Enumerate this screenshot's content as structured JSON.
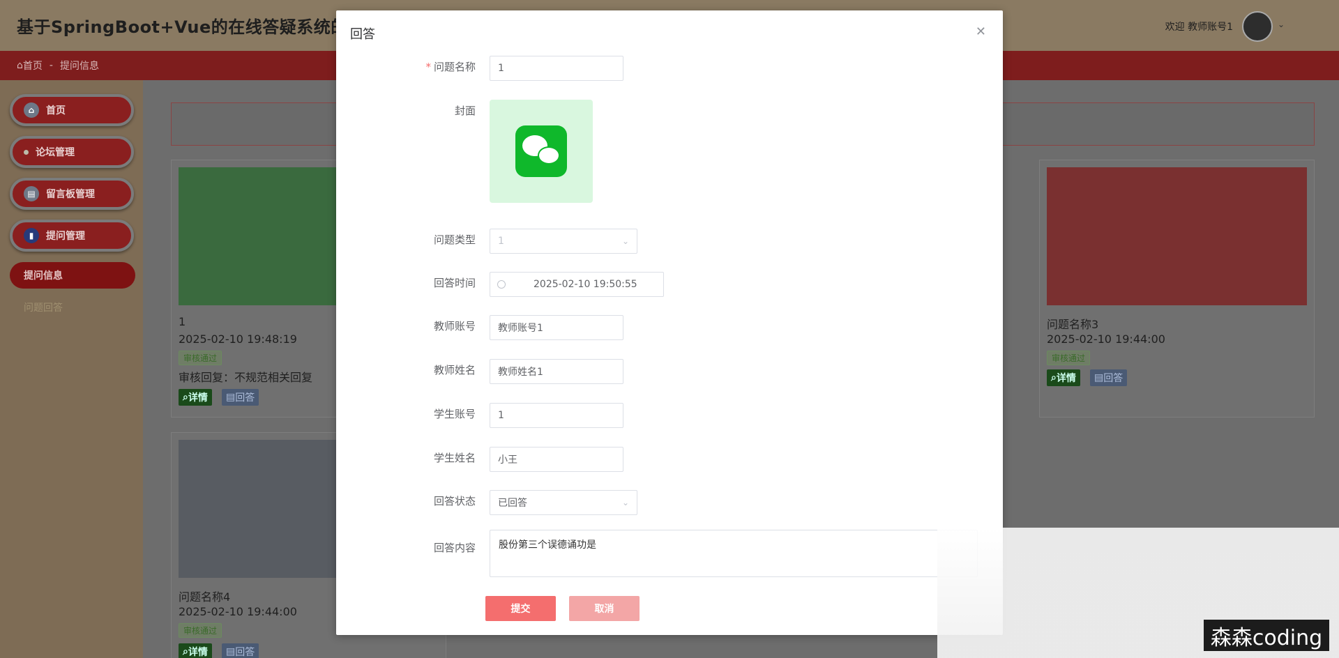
{
  "header": {
    "title": "基于SpringBoot+Vue的在线答疑系统的设计",
    "welcome": "欢迎 教师账号1"
  },
  "breadcrumb": {
    "home": "首页",
    "sep": "-",
    "current": "提问信息"
  },
  "sidebar": {
    "items": [
      {
        "label": "首页",
        "icon": "home-icon"
      },
      {
        "label": "论坛管理",
        "icon": "dot-icon"
      },
      {
        "label": "留言板管理",
        "icon": "board-icon"
      },
      {
        "label": "提问管理",
        "icon": "book-icon"
      }
    ],
    "active": "提问信息",
    "sub": "问题回答"
  },
  "cards": [
    {
      "name": "1",
      "time": "2025-02-10 19:48:19",
      "badge": "审核通过",
      "reply": "审核回复：不规范相关回复",
      "detail": "详情",
      "answer": "回答"
    },
    {
      "name": "问题名称3",
      "time": "2025-02-10 19:44:00",
      "badge": "审核通过",
      "detail": "详情",
      "answer": "回答"
    },
    {
      "name": "问题名称4",
      "time": "2025-02-10 19:44:00",
      "badge": "审核通过",
      "detail": "详情",
      "answer": "回答"
    }
  ],
  "modal": {
    "title": "回答",
    "fields": {
      "question_name_label": "问题名称",
      "question_name": "1",
      "cover_label": "封面",
      "type_label": "问题类型",
      "type_value": "1",
      "time_label": "回答时间",
      "time_value": "2025-02-10 19:50:55",
      "teacher_account_label": "教师账号",
      "teacher_account": "教师账号1",
      "teacher_name_label": "教师姓名",
      "teacher_name": "教师姓名1",
      "student_account_label": "学生账号",
      "student_account": "1",
      "student_name_label": "学生姓名",
      "student_name": "小王",
      "status_label": "回答状态",
      "status_value": "已回答",
      "content_label": "回答内容",
      "content_value": "股份第三个误德诵功是"
    },
    "submit": "提交",
    "cancel": "取消"
  },
  "watermark": "森森coding",
  "colors": {
    "accent": "#f46e6e",
    "wechat": "#0fb82b"
  }
}
